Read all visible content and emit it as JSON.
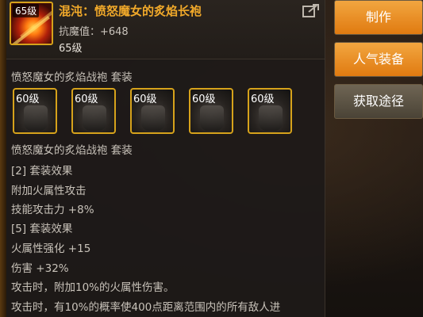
{
  "item": {
    "level_badge": "65级",
    "title": "混沌：愤怒魔女的炙焰长袍",
    "stat": "抗魔值：+648",
    "level": "65级"
  },
  "set": {
    "header": "愤怒魔女的炙焰战袍  套装",
    "pieces": [
      {
        "level": "60级"
      },
      {
        "level": "60级"
      },
      {
        "level": "60级"
      },
      {
        "level": "60级"
      },
      {
        "level": "60级"
      }
    ],
    "name_line": "愤怒魔女的炙焰战袍  套装",
    "effect2_title": "[2] 套装效果",
    "effect2_line1": "附加火属性攻击",
    "effect2_line2": "技能攻击力 +8%",
    "effect5_title": "[5] 套装效果",
    "effect5_line1": "火属性强化 +15",
    "effect5_line2": "伤害 +32%",
    "effect5_line3": "攻击时，附加10%的火属性伤害。",
    "effect5_line4": "攻击时，有10%的概率使400点距离范围内的所有敌人进"
  },
  "side_buttons": {
    "craft": "制作",
    "popular": "人气装备",
    "source": "获取途径"
  },
  "icons": {
    "share": "share-icon",
    "item": "flaming-robe-icon",
    "set_piece": "armor-piece-icon"
  }
}
